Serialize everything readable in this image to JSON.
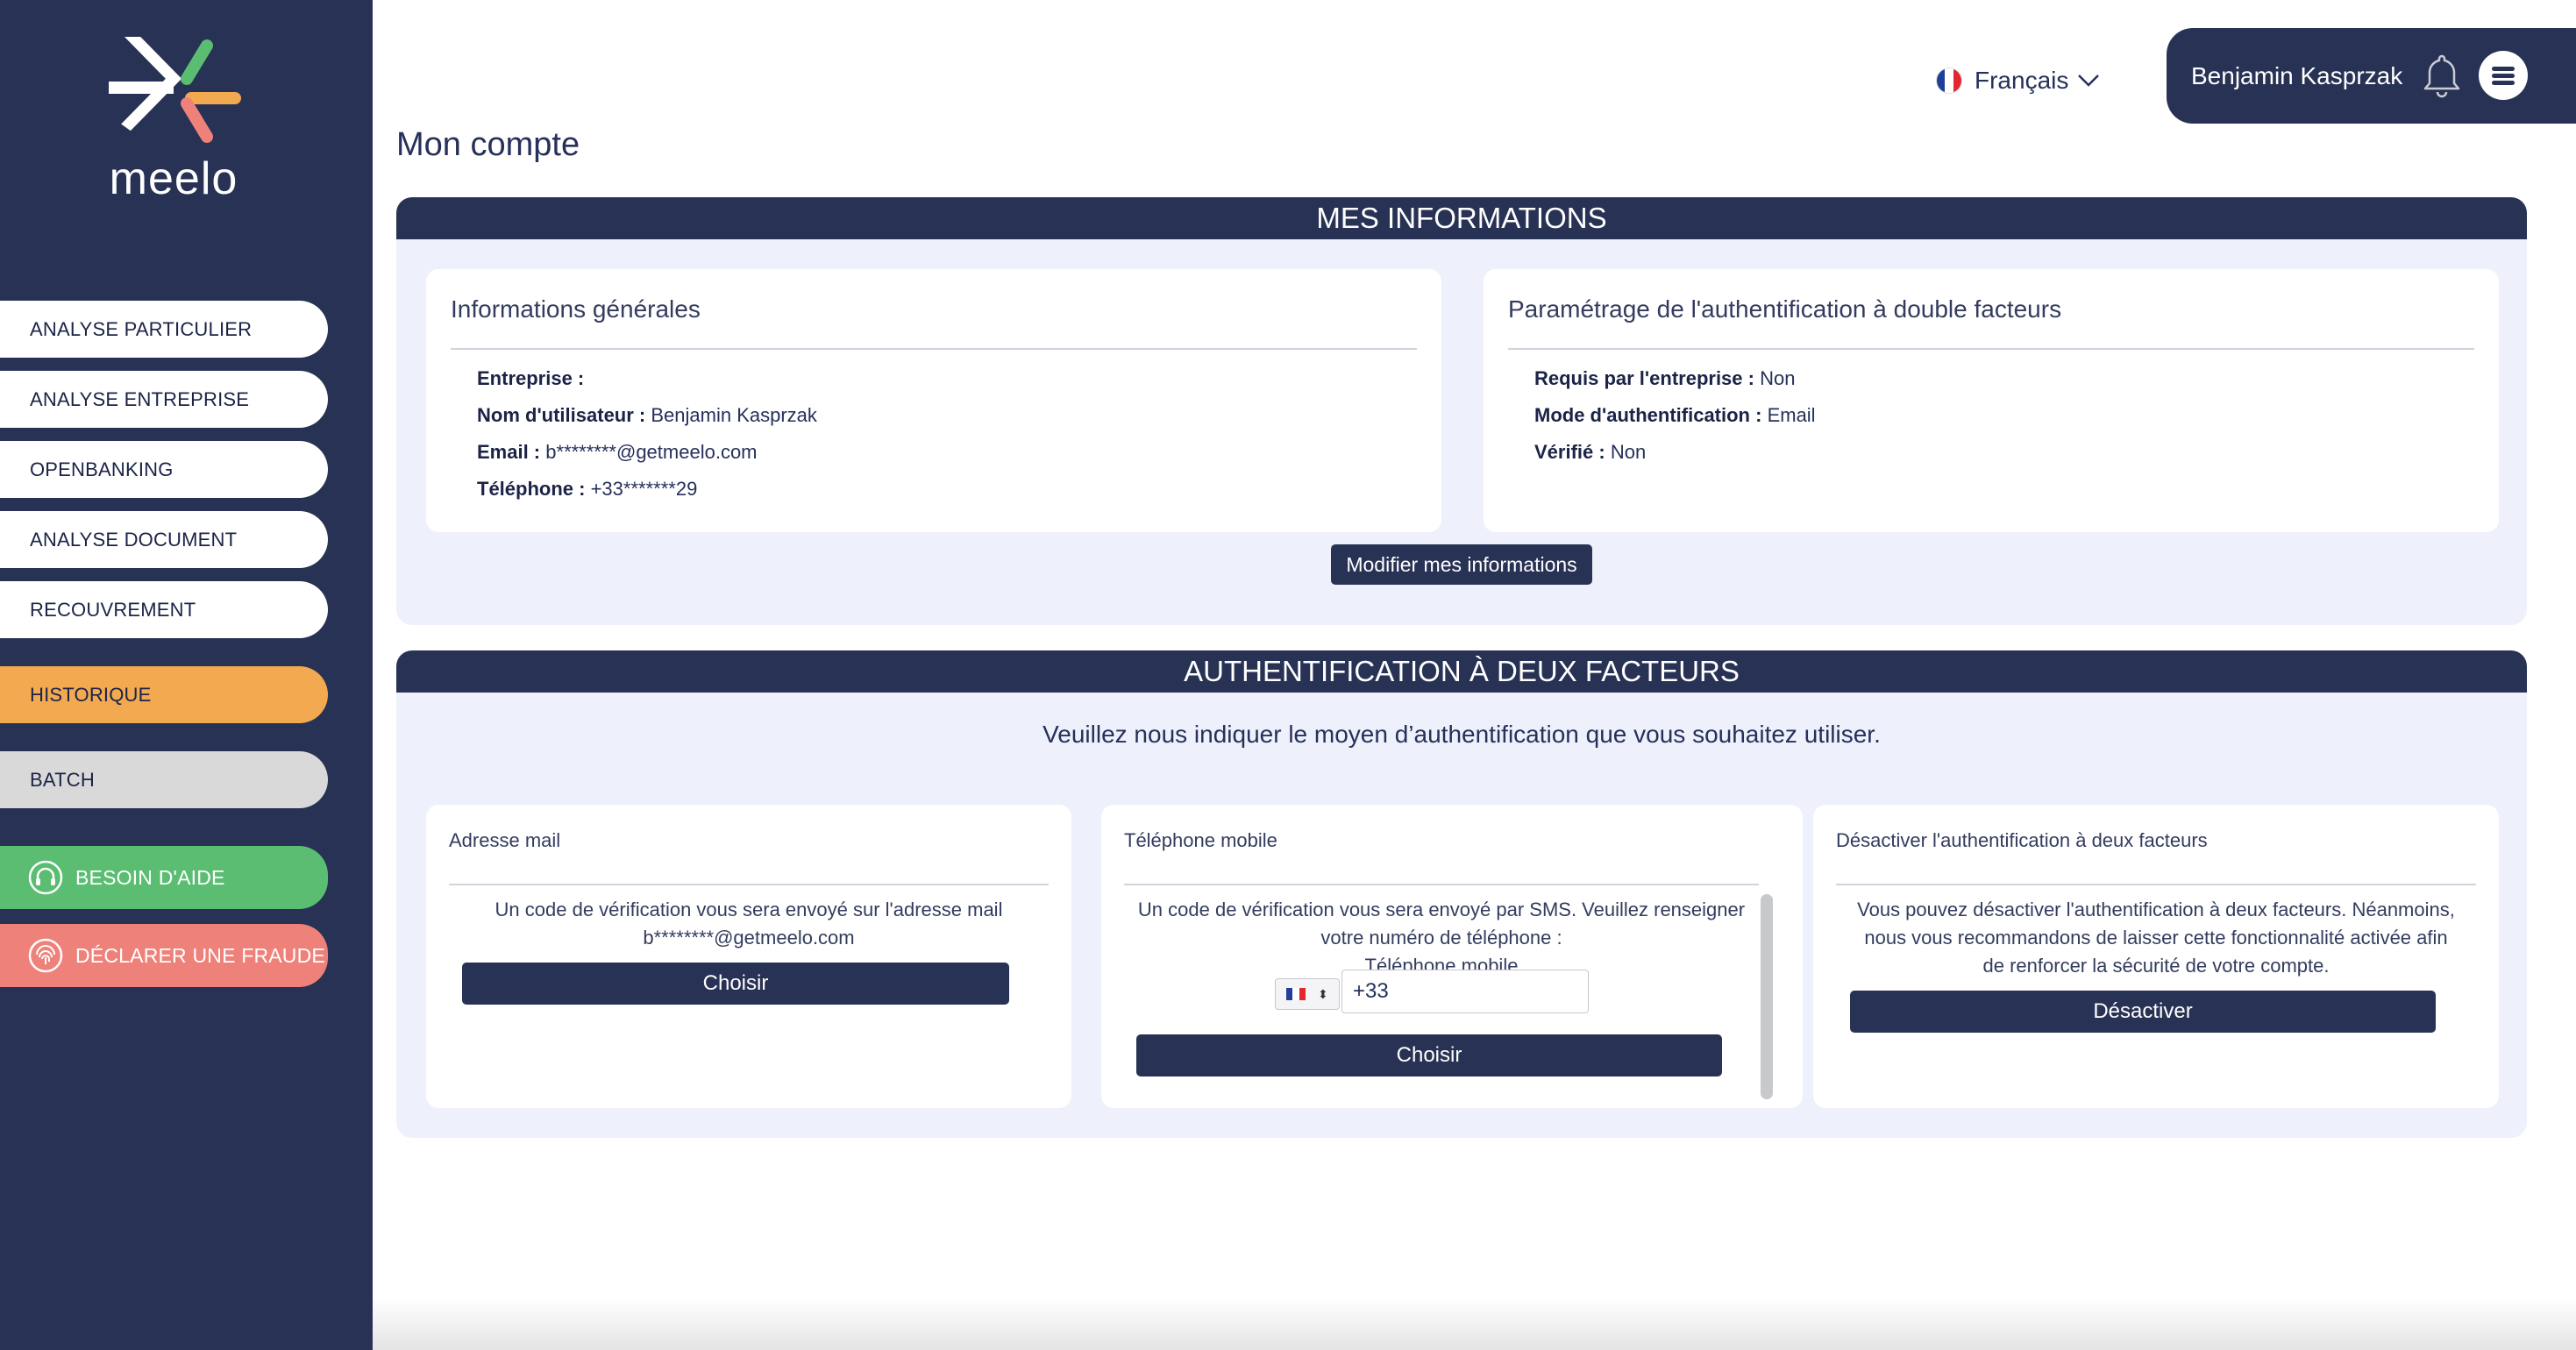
{
  "brand": {
    "name": "meelo",
    "colors": {
      "sidebar": "#283254",
      "accent_orange": "#f2a950",
      "green": "#5bbd72",
      "red": "#ee827b",
      "grey": "#d9d9d9"
    }
  },
  "sidebar": {
    "items": [
      {
        "label": "ANALYSE PARTICULIER"
      },
      {
        "label": "ANALYSE ENTREPRISE"
      },
      {
        "label": "OPENBANKING"
      },
      {
        "label": "ANALYSE DOCUMENT"
      },
      {
        "label": "RECOUVREMENT"
      },
      {
        "label": "HISTORIQUE",
        "active": true
      },
      {
        "label": "BATCH"
      },
      {
        "label": "BESOIN D'AIDE",
        "icon": "headset-icon"
      },
      {
        "label": "DÉCLARER UNE FRAUDE",
        "icon": "fingerprint-icon"
      }
    ]
  },
  "header": {
    "language": "Français",
    "user_name": "Benjamin Kasprzak"
  },
  "page_title": "Mon compte",
  "infos": {
    "section_title": "MES INFORMATIONS",
    "general": {
      "title": "Informations générales",
      "rows": [
        {
          "label": "Entreprise :",
          "value": ""
        },
        {
          "label": "Nom d'utilisateur :",
          "value": "Benjamin Kasprzak"
        },
        {
          "label": "Email :",
          "value": "b********@getmeelo.com"
        },
        {
          "label": "Téléphone :",
          "value": "+33*******29"
        }
      ]
    },
    "twofa_settings": {
      "title": "Paramétrage de l'authentification à double facteurs",
      "rows": [
        {
          "label": "Requis par l'entreprise :",
          "value": "Non"
        },
        {
          "label": "Mode d'authentification :",
          "value": "Email"
        },
        {
          "label": "Vérifié :",
          "value": "Non"
        }
      ]
    },
    "edit_button": "Modifier mes informations"
  },
  "twofa": {
    "section_title": "AUTHENTIFICATION À DEUX FACTEURS",
    "prompt": "Veuillez nous indiquer le moyen d’authentification que vous souhaitez utiliser.",
    "email_card": {
      "title": "Adresse mail",
      "text_line1": "Un code de vérification vous sera envoyé sur l'adresse mail",
      "text_line2": "b********@getmeelo.com",
      "button": "Choisir"
    },
    "phone_card": {
      "title": "Téléphone mobile",
      "text_line1": "Un code de vérification vous sera envoyé par SMS. Veuillez renseigner",
      "text_line2": "votre numéro de téléphone :",
      "field_label": "Téléphone mobile",
      "phone_value": "+33",
      "button": "Choisir"
    },
    "disable_card": {
      "title": "Désactiver l'authentification à deux facteurs",
      "text_line1": "Vous pouvez désactiver l'authentification à deux facteurs. Néanmoins,",
      "text_line2": "nous vous recommandons de laisser cette fonctionnalité activée afin",
      "text_line3": "de renforcer la sécurité de votre compte.",
      "button": "Désactiver"
    }
  }
}
